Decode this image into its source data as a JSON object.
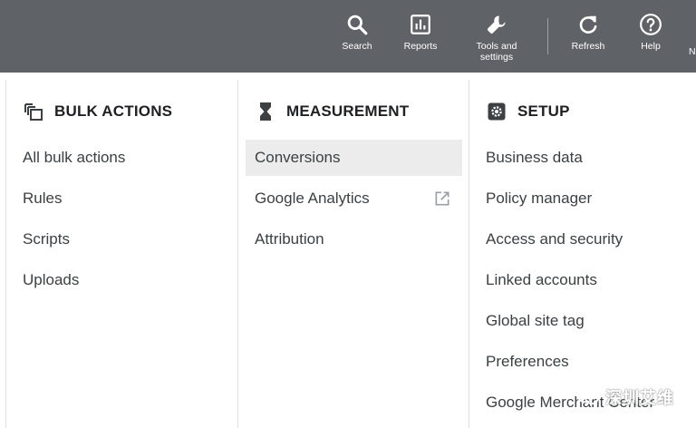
{
  "toolbar": {
    "search_label": "Search",
    "reports_label": "Reports",
    "tools_label": "Tools and\nsettings",
    "refresh_label": "Refresh",
    "help_label": "Help",
    "cut_label": "N"
  },
  "columns": [
    {
      "heading": "BULK ACTIONS",
      "icon": "copy-stack-icon",
      "items": [
        "All bulk actions",
        "Rules",
        "Scripts",
        "Uploads"
      ]
    },
    {
      "heading": "MEASUREMENT",
      "icon": "hourglass-icon",
      "items": [
        "Conversions",
        "Google Analytics",
        "Attribution"
      ],
      "active_index": 0,
      "external_link_index": 1
    },
    {
      "heading": "SETUP",
      "icon": "gear-icon",
      "items": [
        "Business data",
        "Policy manager",
        "Access and security",
        "Linked accounts",
        "Global site tag",
        "Preferences",
        "Google Merchant Center"
      ]
    }
  ],
  "watermark": "深圳艾维",
  "colors": {
    "toolbar_bg": "#5f6368",
    "active_item_bg": "#ececec",
    "divider": "#e0e0e0"
  }
}
